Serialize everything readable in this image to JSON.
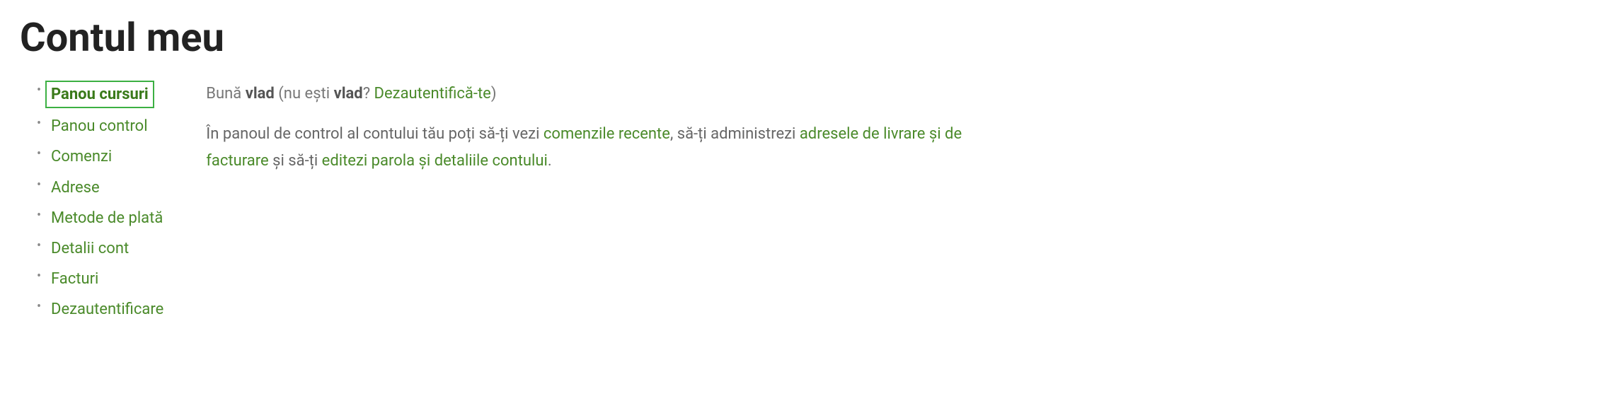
{
  "page": {
    "title": "Contul meu"
  },
  "sidebar": {
    "items": [
      {
        "label": "Panou cursuri",
        "active": true
      },
      {
        "label": "Panou control",
        "active": false
      },
      {
        "label": "Comenzi",
        "active": false
      },
      {
        "label": "Adrese",
        "active": false
      },
      {
        "label": "Metode de plată",
        "active": false
      },
      {
        "label": "Detalii cont",
        "active": false
      },
      {
        "label": "Facturi",
        "active": false
      },
      {
        "label": "Dezautentificare",
        "active": false
      }
    ]
  },
  "greeting": {
    "hello": "Bună ",
    "username": "vlad",
    "not_prefix": " (nu ești ",
    "not_username": "vlad",
    "question": "? ",
    "logout_link": "Dezautentifică-te",
    "closing": ")"
  },
  "description": {
    "part1": "În panoul de control al contului tău poți să-ți vezi ",
    "link1": "comenzile recente",
    "part2": ", să-ți administrezi ",
    "link2": "adresele de livrare și de facturare",
    "part3": " și să-ți ",
    "link3": "editezi parola și detaliile contului",
    "part4": "."
  }
}
